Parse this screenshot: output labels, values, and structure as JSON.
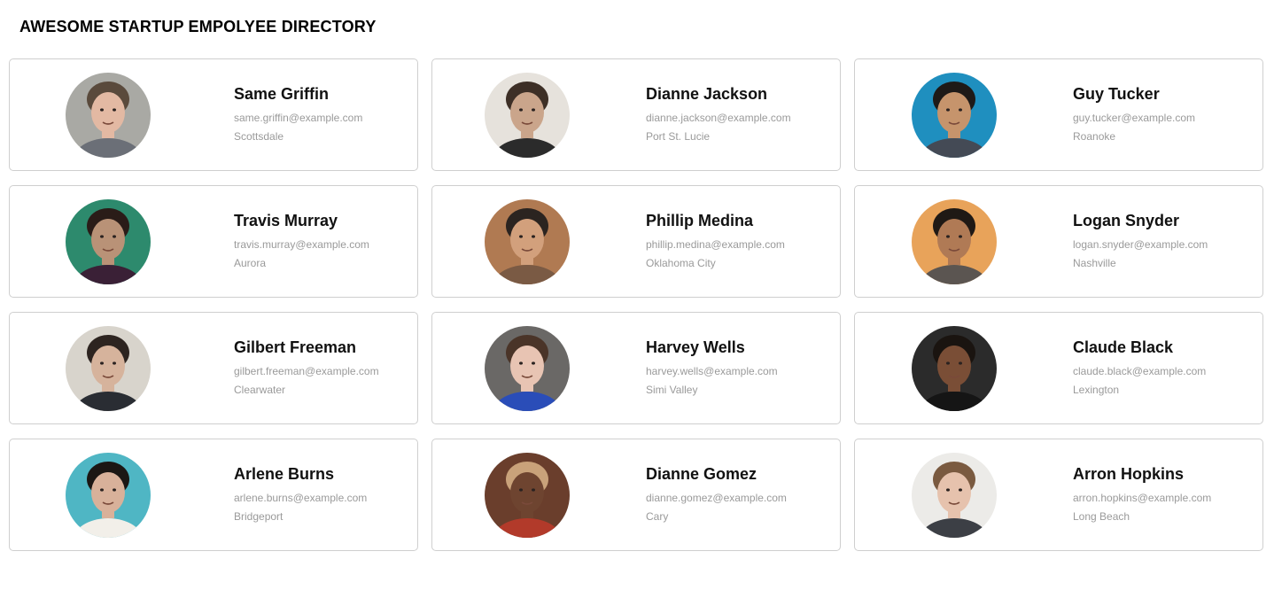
{
  "page": {
    "title": "AWESOME STARTUP EMPOLYEE DIRECTORY"
  },
  "employees": [
    {
      "name": "Same Griffin",
      "email": "same.griffin@example.com",
      "city": "Scottsdale",
      "bg": "#a9a9a4",
      "skin": "#e3b9a3",
      "hair": "#5a4a3c",
      "shirt": "#6b6f77"
    },
    {
      "name": "Dianne Jackson",
      "email": "dianne.jackson@example.com",
      "city": "Port St. Lucie",
      "bg": "#e6e2dc",
      "skin": "#caa58b",
      "hair": "#3d2f26",
      "shirt": "#2b2b2b"
    },
    {
      "name": "Guy Tucker",
      "email": "guy.tucker@example.com",
      "city": "Roanoke",
      "bg": "#1f8fbf",
      "skin": "#c6946c",
      "hair": "#1e1a18",
      "shirt": "#444a55"
    },
    {
      "name": "Travis Murray",
      "email": "travis.murray@example.com",
      "city": "Aurora",
      "bg": "#2d8a6d",
      "skin": "#b99277",
      "hair": "#2a1c18",
      "shirt": "#3a2036"
    },
    {
      "name": "Phillip Medina",
      "email": "phillip.medina@example.com",
      "city": "Oklahoma City",
      "bg": "#b07a52",
      "skin": "#d2a07c",
      "hair": "#2b2420",
      "shirt": "#7a5a44"
    },
    {
      "name": "Logan Snyder",
      "email": "logan.snyder@example.com",
      "city": "Nashville",
      "bg": "#e8a35a",
      "skin": "#b07a55",
      "hair": "#1f1915",
      "shirt": "#5b5551"
    },
    {
      "name": "Gilbert Freeman",
      "email": "gilbert.freeman@example.com",
      "city": "Clearwater",
      "bg": "#d8d4cc",
      "skin": "#d6b39c",
      "hair": "#2d2420",
      "shirt": "#2a2d33"
    },
    {
      "name": "Harvey Wells",
      "email": "harvey.wells@example.com",
      "city": "Simi Valley",
      "bg": "#6a6866",
      "skin": "#e8c4b3",
      "hair": "#4a3428",
      "shirt": "#2a4db8"
    },
    {
      "name": "Claude Black",
      "email": "claude.black@example.com",
      "city": "Lexington",
      "bg": "#2b2b2b",
      "skin": "#7a4e36",
      "hair": "#1a1410",
      "shirt": "#151515"
    },
    {
      "name": "Arlene Burns",
      "email": "arlene.burns@example.com",
      "city": "Bridgeport",
      "bg": "#4fb6c4",
      "skin": "#d8b19a",
      "hair": "#1b1714",
      "shirt": "#f2efe9"
    },
    {
      "name": "Dianne Gomez",
      "email": "dianne.gomez@example.com",
      "city": "Cary",
      "bg": "#6a3e2c",
      "skin": "#6e4430",
      "hair": "#c9a27a",
      "shirt": "#b23a2a"
    },
    {
      "name": "Arron Hopkins",
      "email": "arron.hopkins@example.com",
      "city": "Long Beach",
      "bg": "#ecebe8",
      "skin": "#e6c2ad",
      "hair": "#7a5a40",
      "shirt": "#3c3f45"
    }
  ]
}
